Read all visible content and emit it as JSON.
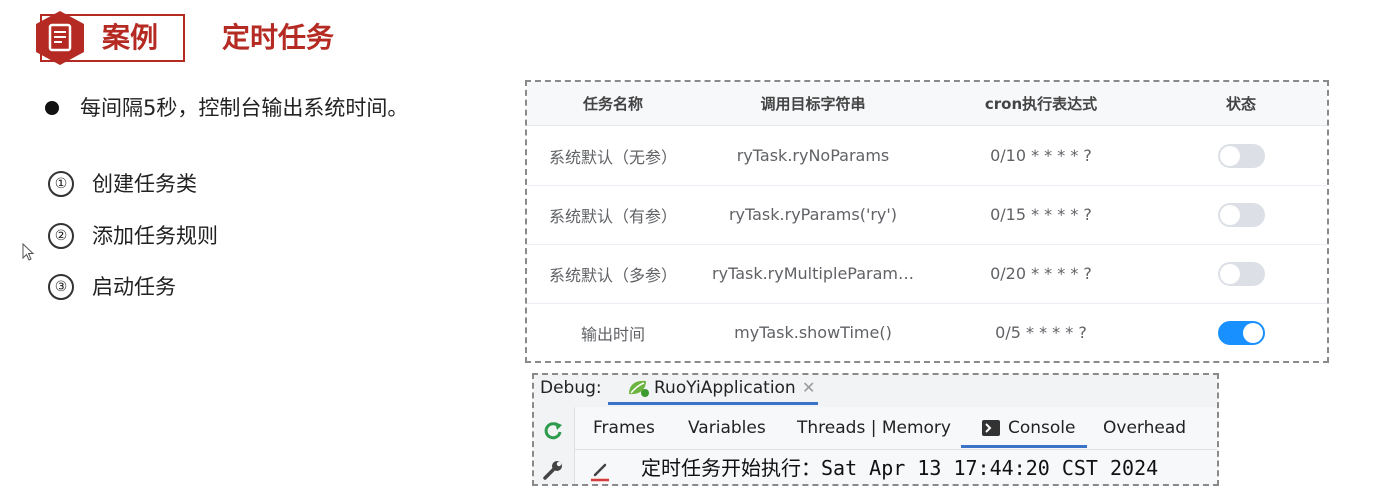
{
  "header": {
    "label": "案例",
    "title": "定时任务",
    "icon": "document-icon",
    "accent": "#b52a22"
  },
  "left": {
    "bullet": "每间隔5秒，控制台输出系统时间。",
    "steps": [
      {
        "num": "①",
        "text": "创建任务类"
      },
      {
        "num": "②",
        "text": "添加任务规则"
      },
      {
        "num": "③",
        "text": "启动任务"
      }
    ]
  },
  "table": {
    "headers": [
      "任务名称",
      "调用目标字符串",
      "cron执行表达式",
      "状态"
    ],
    "rows": [
      {
        "name": "系统默认（无参）",
        "target": "ryTask.ryNoParams",
        "cron": "0/10 * * * * ?",
        "enabled": false
      },
      {
        "name": "系统默认（有参）",
        "target": "ryTask.ryParams('ry')",
        "cron": "0/15 * * * * ?",
        "enabled": false
      },
      {
        "name": "系统默认（多参）",
        "target": "ryTask.ryMultipleParam…",
        "cron": "0/20 * * * * ?",
        "enabled": false
      },
      {
        "name": "输出时间",
        "target": "myTask.showTime()",
        "cron": "0/5 * * * * ?",
        "enabled": true
      }
    ],
    "toggle_on_color": "#1890ff",
    "toggle_off_color": "#dcdfe6"
  },
  "debug": {
    "label": "Debug:",
    "run_config": "RuoYiApplication",
    "tabs": [
      "Frames",
      "Variables",
      "Threads | Memory",
      "Console",
      "Overhead"
    ],
    "active_tab": "Console",
    "console_output": "定时任务开始执行：Sat Apr 13 17:44:20 CST 2024"
  }
}
